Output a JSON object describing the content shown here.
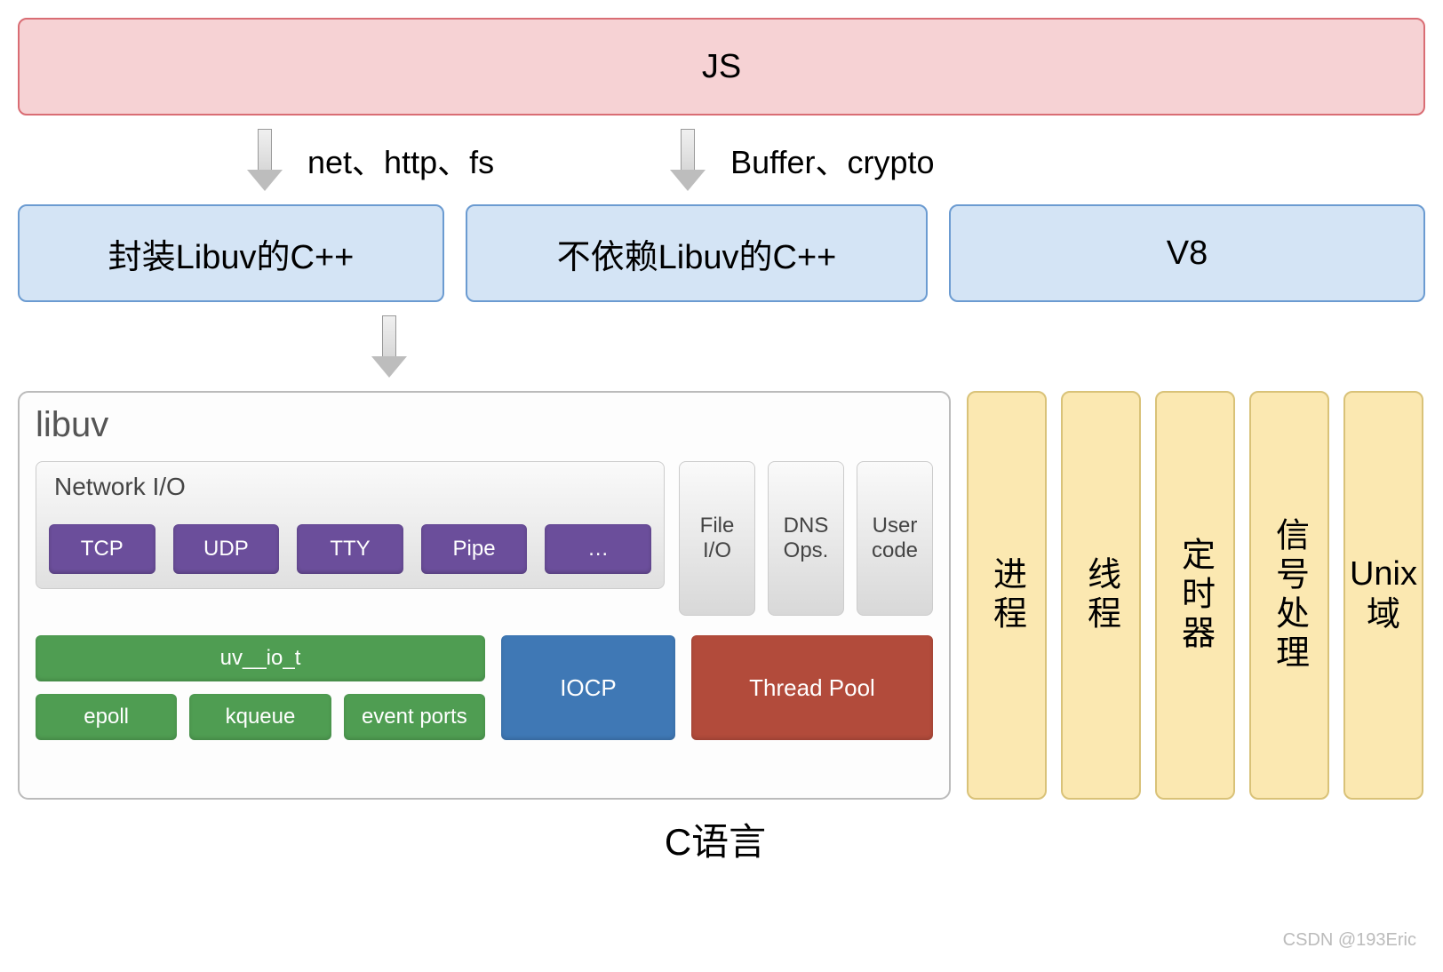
{
  "top": {
    "js": "JS"
  },
  "arrows": {
    "left_label": "net、http、fs",
    "right_label": "Buffer、crypto"
  },
  "layer2": {
    "libuv_cpp": "封装Libuv的C++",
    "nolibuv_cpp": "不依赖Libuv的C++",
    "v8": "V8"
  },
  "libuv": {
    "title": "libuv",
    "network_io": {
      "title": "Network I/O",
      "items": [
        "TCP",
        "UDP",
        "TTY",
        "Pipe",
        "…"
      ]
    },
    "side_pills": [
      "File\nI/O",
      "DNS\nOps.",
      "User\ncode"
    ],
    "green_top": "uv__io_t",
    "green_bottom": [
      "epoll",
      "kqueue",
      "event ports"
    ],
    "iocp": "IOCP",
    "thread_pool": "Thread Pool"
  },
  "right_cols": [
    "进程",
    "线程",
    "定时器",
    "信号处理",
    "Unix域"
  ],
  "bottom": "C语言",
  "watermark": "CSDN @193Eric"
}
